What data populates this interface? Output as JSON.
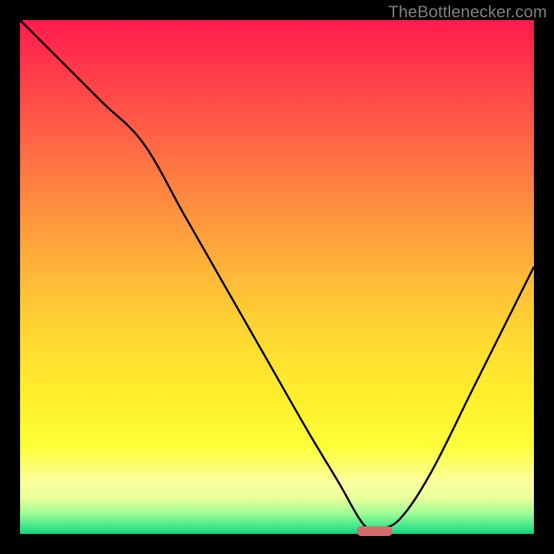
{
  "watermark": "TheBottlenecker.com",
  "colors": {
    "curve_stroke": "#000000",
    "pill_fill": "#d66b6d"
  },
  "chart_data": {
    "type": "line",
    "title": "",
    "xlabel": "",
    "ylabel": "",
    "xlim": [
      0,
      100
    ],
    "ylim": [
      0,
      100
    ],
    "grid": false,
    "legend": false,
    "series": [
      {
        "name": "bottleneck-curve",
        "x": [
          0,
          8,
          16,
          24,
          32,
          40,
          48,
          56,
          62,
          66,
          68,
          70,
          74,
          80,
          88,
          96,
          100
        ],
        "values": [
          100,
          92,
          84,
          76,
          62,
          48,
          34,
          20,
          10,
          3,
          1,
          1,
          3,
          12,
          28,
          44,
          52
        ]
      }
    ],
    "annotations": [
      {
        "name": "optimal-marker",
        "x": 69,
        "y": 0.6,
        "kind": "pill"
      }
    ]
  }
}
